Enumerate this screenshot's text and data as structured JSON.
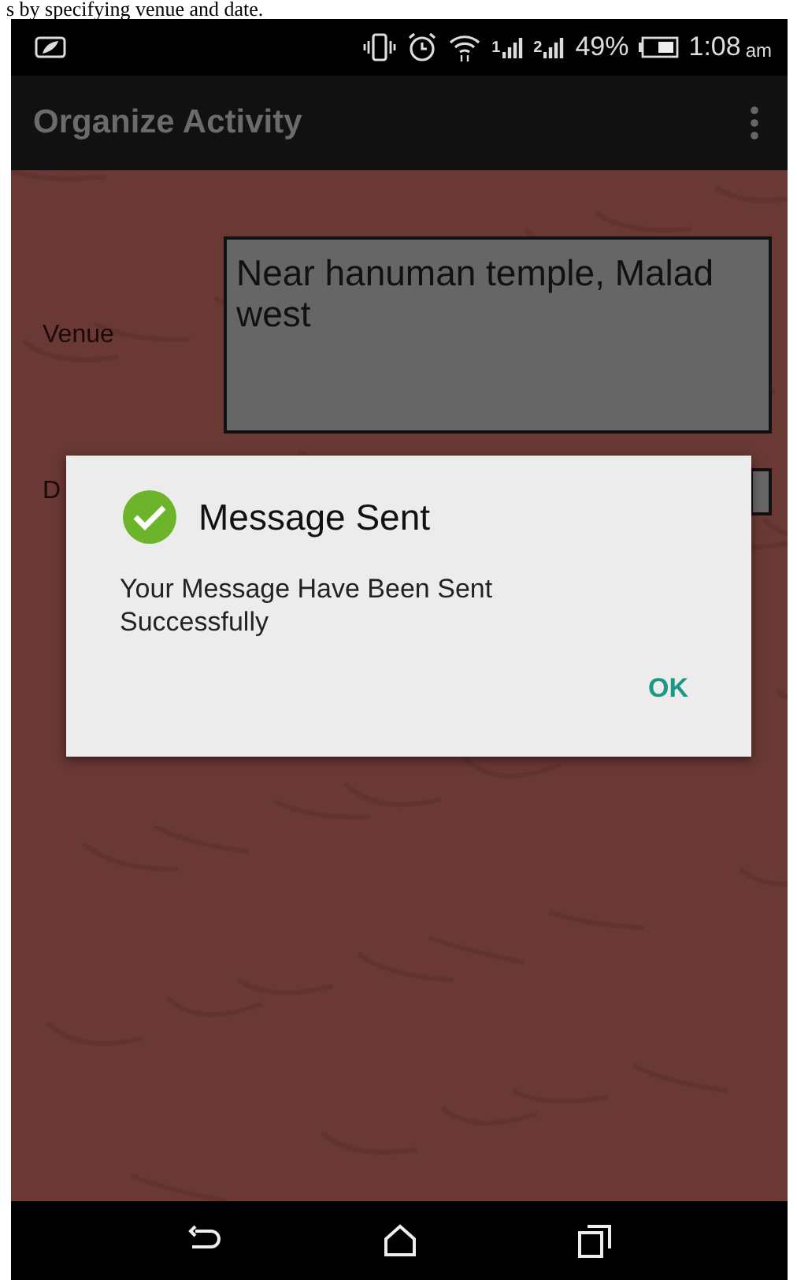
{
  "caption": "s by specifying venue and date.",
  "status_bar": {
    "sim_1": "1",
    "sim_2": "2",
    "battery": "49%",
    "time": "1:08",
    "meridiem": "am"
  },
  "app_bar": {
    "title": "Organize Activity"
  },
  "form": [
    {
      "label": "Venue",
      "value": "Near hanuman temple, Malad west"
    },
    {
      "label": "D"
    }
  ],
  "dialog": {
    "title": "Message Sent",
    "message": "Your Message Have Been Sent Successfully",
    "button": "OK"
  }
}
